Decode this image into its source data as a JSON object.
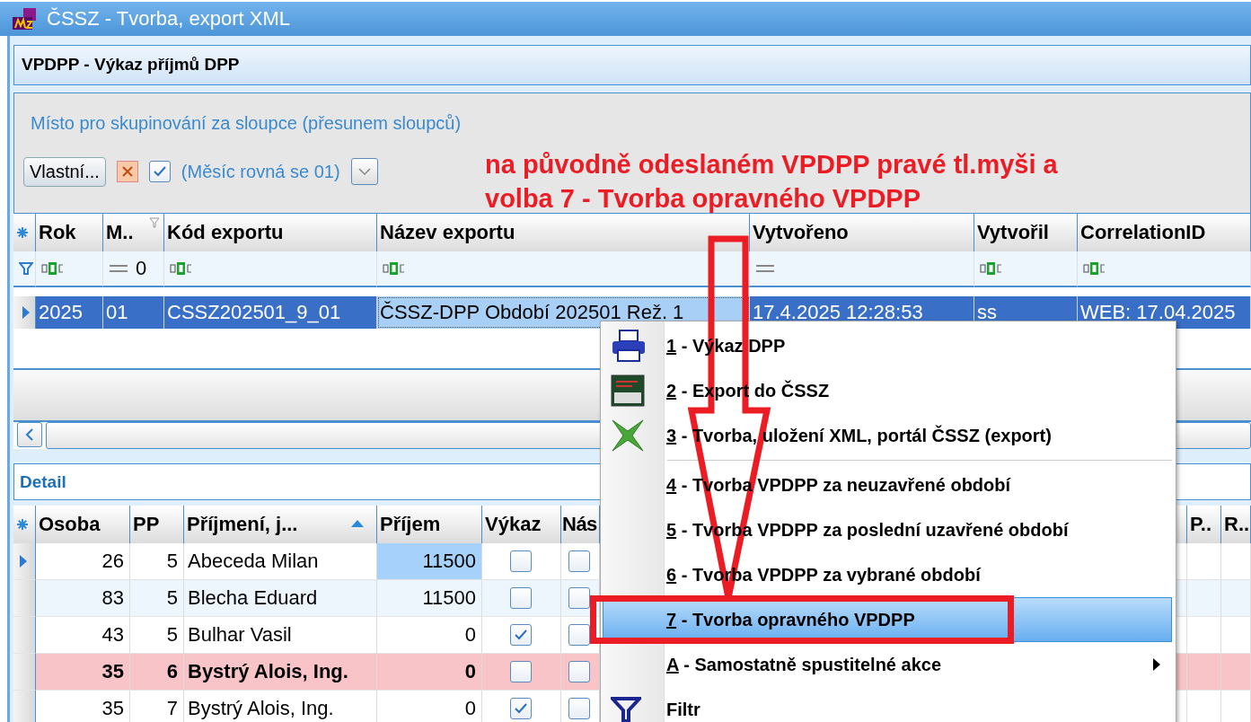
{
  "window": {
    "title": "ČSSZ - Tvorba, export XML"
  },
  "panel": {
    "title": "VPDPP - Výkaz příjmů DPP"
  },
  "group_area": {
    "hint": "Místo pro skupinování za sloupce (přesunem sloupců)"
  },
  "filter_bar": {
    "button": "Vlastní...",
    "enabled": true,
    "filter_text": "(Měsíc rovná se 01)"
  },
  "annotation": {
    "lines": [
      "na původně odeslaném VPDPP pravé tl.myši a",
      "volba 7 - Tvorba opravného VPDPP"
    ]
  },
  "export_grid": {
    "columns": [
      {
        "label": "Rok",
        "filter_icon": false
      },
      {
        "label": "M..",
        "filter_icon": true
      },
      {
        "label": "Kód exportu",
        "filter_icon": false
      },
      {
        "label": "Název exportu",
        "filter_icon": false
      },
      {
        "label": "Vytvořeno",
        "filter_icon": false
      },
      {
        "label": "Vytvořil",
        "filter_icon": false
      },
      {
        "label": "CorrelationID",
        "filter_icon": false
      }
    ],
    "filter_row": [
      {
        "kind": "text"
      },
      {
        "kind": "equals",
        "value": "0"
      },
      {
        "kind": "text"
      },
      {
        "kind": "text"
      },
      {
        "kind": "equals"
      },
      {
        "kind": "text"
      },
      {
        "kind": "text"
      }
    ],
    "rows": [
      {
        "selected": true,
        "cells": [
          {
            "text": "2025",
            "focused": false
          },
          {
            "text": "01",
            "focused": false
          },
          {
            "text": "CSSZ202501_9_01",
            "focused": false
          },
          {
            "text": "ČSSZ-DPP Období 202501 Rež. 1",
            "focused": true
          },
          {
            "text": "17.4.2025 12:28:53",
            "focused": false
          },
          {
            "text": "ss",
            "focused": false
          },
          {
            "text": "WEB: 17.04.2025",
            "focused": false
          }
        ]
      }
    ]
  },
  "detail": {
    "title": "Detail",
    "columns": [
      {
        "label": "Osoba",
        "sorted": false
      },
      {
        "label": "PP",
        "sorted": false
      },
      {
        "label": "Příjmení, j...",
        "sorted": true
      },
      {
        "label": "Příjem",
        "sorted": false
      },
      {
        "label": "Výkaz",
        "sorted": false
      },
      {
        "label": "Nás",
        "sorted": false
      },
      {
        "label": "P..",
        "sorted": false
      },
      {
        "label": "R..",
        "sorted": false
      }
    ],
    "rows": [
      {
        "current": true,
        "flagged": false,
        "osoba": "26",
        "pp": "5",
        "name": "Abeceda Milan",
        "income": "11500",
        "income_focused": true,
        "vykaz": false,
        "nas": false
      },
      {
        "current": false,
        "flagged": false,
        "osoba": "83",
        "pp": "5",
        "name": "Blecha Eduard",
        "income": "11500",
        "income_focused": false,
        "vykaz": false,
        "nas": false
      },
      {
        "current": false,
        "flagged": false,
        "osoba": "43",
        "pp": "5",
        "name": "Bulhar Vasil",
        "income": "0",
        "income_focused": false,
        "vykaz": true,
        "nas": false
      },
      {
        "current": false,
        "flagged": true,
        "osoba": "35",
        "pp": "6",
        "name": "Bystrý Alois, Ing.",
        "income": "0",
        "income_focused": false,
        "vykaz": false,
        "nas": false
      },
      {
        "current": false,
        "flagged": false,
        "osoba": "35",
        "pp": "7",
        "name": "Bystrý Alois, Ing.",
        "income": "0",
        "income_focused": false,
        "vykaz": true,
        "nas": false
      }
    ]
  },
  "context_menu": {
    "items": [
      {
        "kind": "item",
        "hotkey": "1",
        "text": "- Výkaz DPP",
        "selected": false
      },
      {
        "kind": "item",
        "hotkey": "2",
        "text": "- Export do ČSSZ",
        "selected": false
      },
      {
        "kind": "item",
        "hotkey": "3",
        "text": "- Tvorba, uložení XML, portál ČSSZ (export)",
        "selected": false
      },
      {
        "kind": "separator"
      },
      {
        "kind": "item",
        "hotkey": "4",
        "text": "- Tvorba VPDPP za neuzavřené období",
        "selected": false
      },
      {
        "kind": "item",
        "hotkey": "5",
        "text": "- Tvorba VPDPP za poslední uzavřené období",
        "selected": false
      },
      {
        "kind": "item",
        "hotkey": "6",
        "text": "- Tvorba VPDPP za vybrané období",
        "selected": false
      },
      {
        "kind": "item",
        "hotkey": "7",
        "text": "- Tvorba opravného VPDPP",
        "selected": true
      },
      {
        "kind": "submenu",
        "hotkey": "A",
        "text": "- Samostatně spustitelné akce",
        "selected": false
      },
      {
        "kind": "item",
        "text": "Filtr",
        "selected": false
      }
    ]
  }
}
